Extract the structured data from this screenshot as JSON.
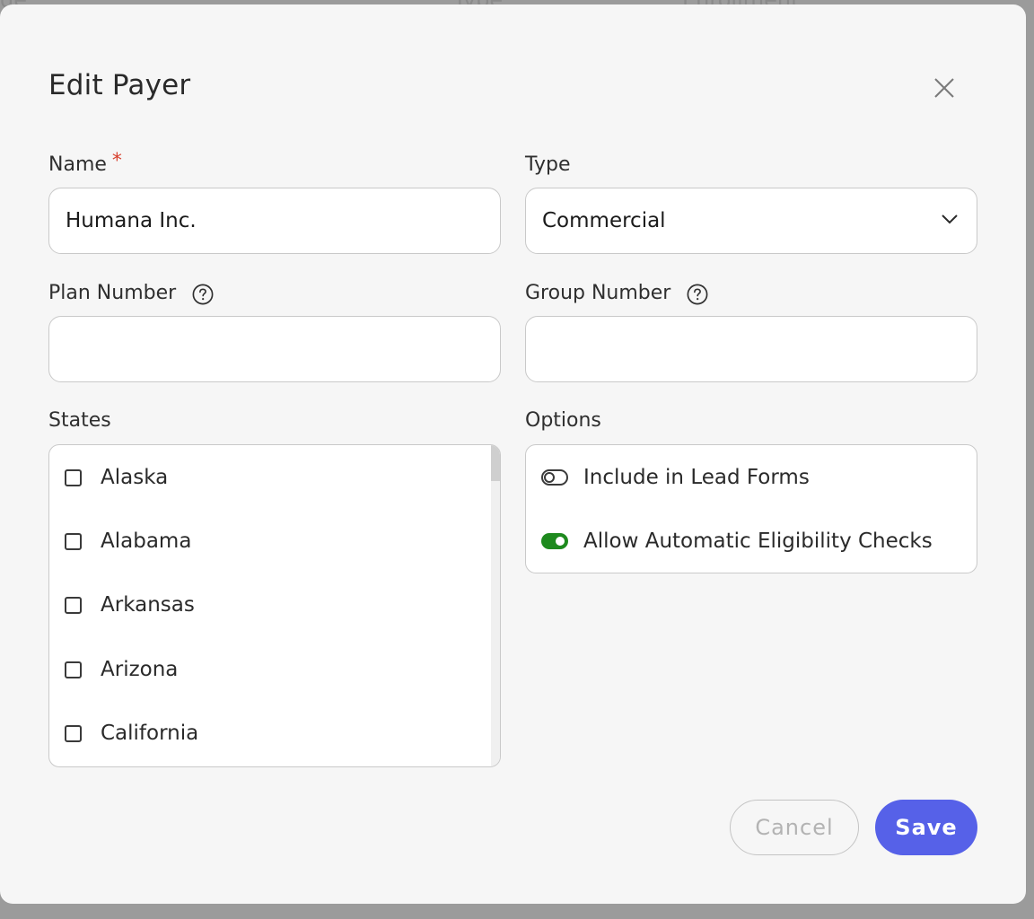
{
  "background": {
    "header_fragments": [
      "de",
      "Type",
      "Enrollment"
    ]
  },
  "modal": {
    "title": "Edit Payer",
    "close_icon": "close-icon"
  },
  "form": {
    "name": {
      "label": "Name",
      "required_mark": "*",
      "value": "Humana Inc."
    },
    "type": {
      "label": "Type",
      "selected": "Commercial"
    },
    "plan_number": {
      "label": "Plan Number",
      "value": "",
      "help_icon": "question-circle-icon"
    },
    "group_number": {
      "label": "Group Number",
      "value": "",
      "help_icon": "question-circle-icon"
    },
    "states": {
      "label": "States",
      "items": [
        {
          "label": "Alaska",
          "checked": false
        },
        {
          "label": "Alabama",
          "checked": false
        },
        {
          "label": "Arkansas",
          "checked": false
        },
        {
          "label": "Arizona",
          "checked": false
        },
        {
          "label": "California",
          "checked": false
        }
      ]
    },
    "options": {
      "label": "Options",
      "items": [
        {
          "label": "Include in Lead Forms",
          "enabled": false
        },
        {
          "label": "Allow Automatic Eligibility Checks",
          "enabled": true
        }
      ]
    }
  },
  "actions": {
    "cancel_label": "Cancel",
    "save_label": "Save"
  },
  "colors": {
    "accent": "#5661e8",
    "toggle_on": "#1e8a1e",
    "required": "#d8412f"
  }
}
